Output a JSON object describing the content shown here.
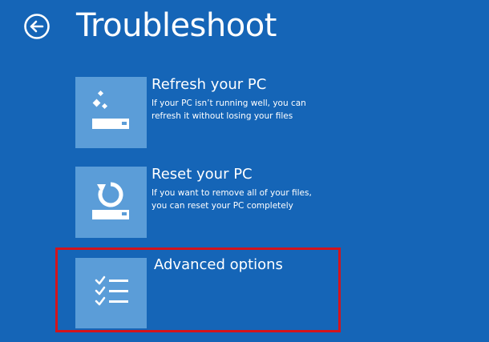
{
  "header": {
    "title": "Troubleshoot",
    "back_icon": "arrow-left-circle-icon"
  },
  "options": [
    {
      "title": "Refresh your PC",
      "description_lines": [
        "If your PC isn’t running well, you can",
        "refresh it without losing your files"
      ],
      "icon": "refresh-sparkle-drive-icon"
    },
    {
      "title": "Reset your PC",
      "description_lines": [
        "If you want to remove all of your files,",
        "you can reset your PC completely"
      ],
      "icon": "reset-circular-arrow-icon"
    },
    {
      "title": "Advanced options",
      "description_lines": [],
      "icon": "checklist-icon"
    }
  ],
  "colors": {
    "background": "#1565b7",
    "tile": "#5b9dd8",
    "text": "#ffffff",
    "highlight": "#d3141c"
  }
}
